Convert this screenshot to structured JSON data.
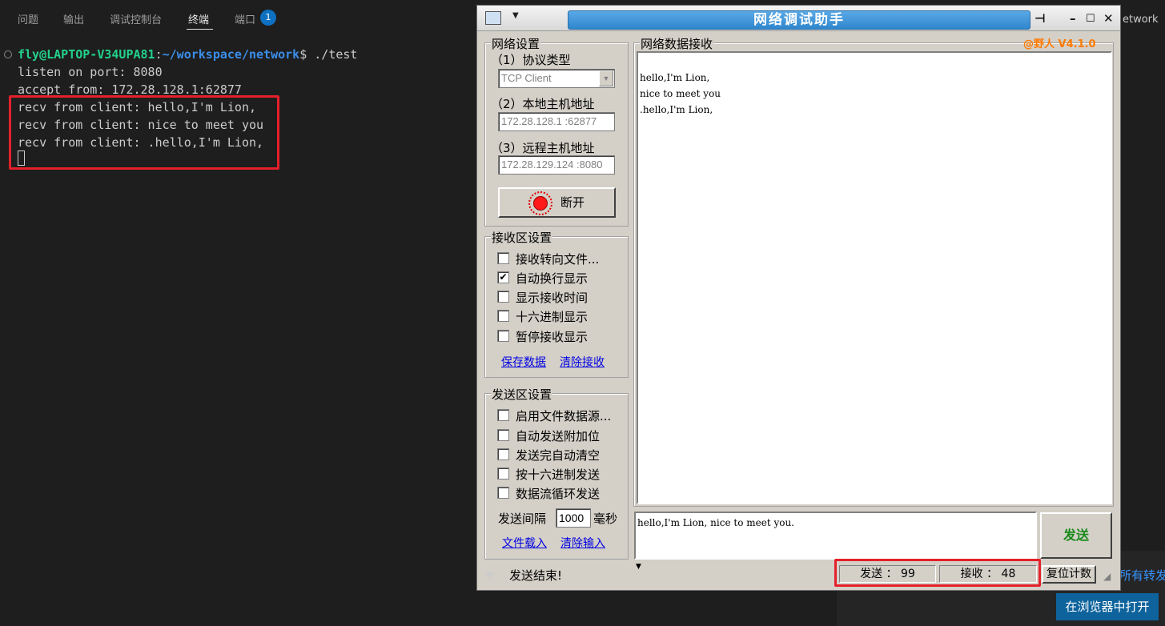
{
  "vscode": {
    "tabs": [
      "问题",
      "输出",
      "调试控制台",
      "终端",
      "端口"
    ],
    "active_tab": "终端",
    "port_badge": "1",
    "prompt": {
      "user": "fly@LAPTOP-V34UPA81",
      "path": "~/workspace/network",
      "suffix": "$ ./test",
      "sep": ":"
    },
    "terminal_lines": [
      "listen on port: 8080",
      "accept from: 172.28.128.1:62877",
      "recv from client: hello,I'm Lion,",
      "recv from client: nice to meet you",
      "recv from client: .hello,I'm Lion,"
    ],
    "right_edge_text": "etwork",
    "notification_link_text": "所有转发",
    "open_in_browser_button": "在浏览器中打开"
  },
  "app": {
    "title": "网络调试助手",
    "version": "@野人 V4.1.0",
    "network_settings": {
      "title": "网络设置",
      "protocol_label": "（1）协议类型",
      "protocol_value": "TCP Client",
      "local_label": "（2）本地主机地址",
      "local_value": "172.28.128.1 :62877",
      "remote_label": "（3）远程主机地址",
      "remote_value": "172.28.129.124 :8080",
      "disconnect_button": "断开"
    },
    "receive_settings": {
      "title": "接收区设置",
      "options": [
        {
          "label": "接收转向文件...",
          "checked": false
        },
        {
          "label": "自动换行显示",
          "checked": true
        },
        {
          "label": "显示接收时间",
          "checked": false
        },
        {
          "label": "十六进制显示",
          "checked": false
        },
        {
          "label": "暂停接收显示",
          "checked": false
        }
      ],
      "save_link": "保存数据",
      "clear_link": "清除接收"
    },
    "send_settings": {
      "title": "发送区设置",
      "options": [
        {
          "label": "启用文件数据源...",
          "checked": false
        },
        {
          "label": "自动发送附加位",
          "checked": false
        },
        {
          "label": "发送完自动清空",
          "checked": false
        },
        {
          "label": "按十六进制发送",
          "checked": false
        },
        {
          "label": "数据流循环发送",
          "checked": false
        }
      ],
      "interval_label": "发送间隔",
      "interval_value": "1000",
      "interval_unit": "毫秒",
      "load_link": "文件载入",
      "clear_link": "清除输入"
    },
    "receive_area": {
      "title": "网络数据接收",
      "lines": [
        "hello,I'm Lion,",
        "nice to meet you",
        ".hello,I'm Lion,"
      ]
    },
    "send_area": {
      "text": "hello,I'm Lion, nice to meet you.",
      "send_button": "发送"
    },
    "status": {
      "message": "发送结束!",
      "sent": "发送 ： 99",
      "received": "接收 ： 48",
      "reset_button": "复位计数"
    }
  },
  "colors": {
    "highlight_box": "#e5202a",
    "title_bar": "#2f86cd",
    "prompt_user": "#23d18b",
    "prompt_path": "#3b8eea"
  }
}
